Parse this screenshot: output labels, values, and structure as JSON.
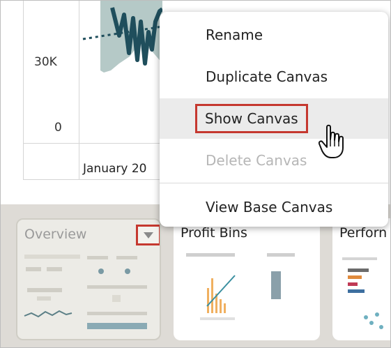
{
  "chart": {
    "y_ticks": [
      "30K",
      "0"
    ],
    "x_tick": "January 20",
    "series_color": "#1f4e5c",
    "band_color": "#b5c9c7"
  },
  "context_menu": {
    "items": [
      {
        "label": "Rename",
        "state": "normal"
      },
      {
        "label": "Duplicate Canvas",
        "state": "normal"
      },
      {
        "label": "Show Canvas",
        "state": "hovered"
      },
      {
        "label": "Delete Canvas",
        "state": "disabled"
      },
      {
        "label": "View Base Canvas",
        "state": "normal"
      }
    ],
    "highlight_color": "#c5382f"
  },
  "canvases": [
    {
      "title": "Overview",
      "active": true
    },
    {
      "title": "Profit Bins",
      "active": false
    },
    {
      "title": "Perforn",
      "active": false
    }
  ],
  "icons": [
    "chevron-down-icon",
    "hand-pointer-icon"
  ]
}
